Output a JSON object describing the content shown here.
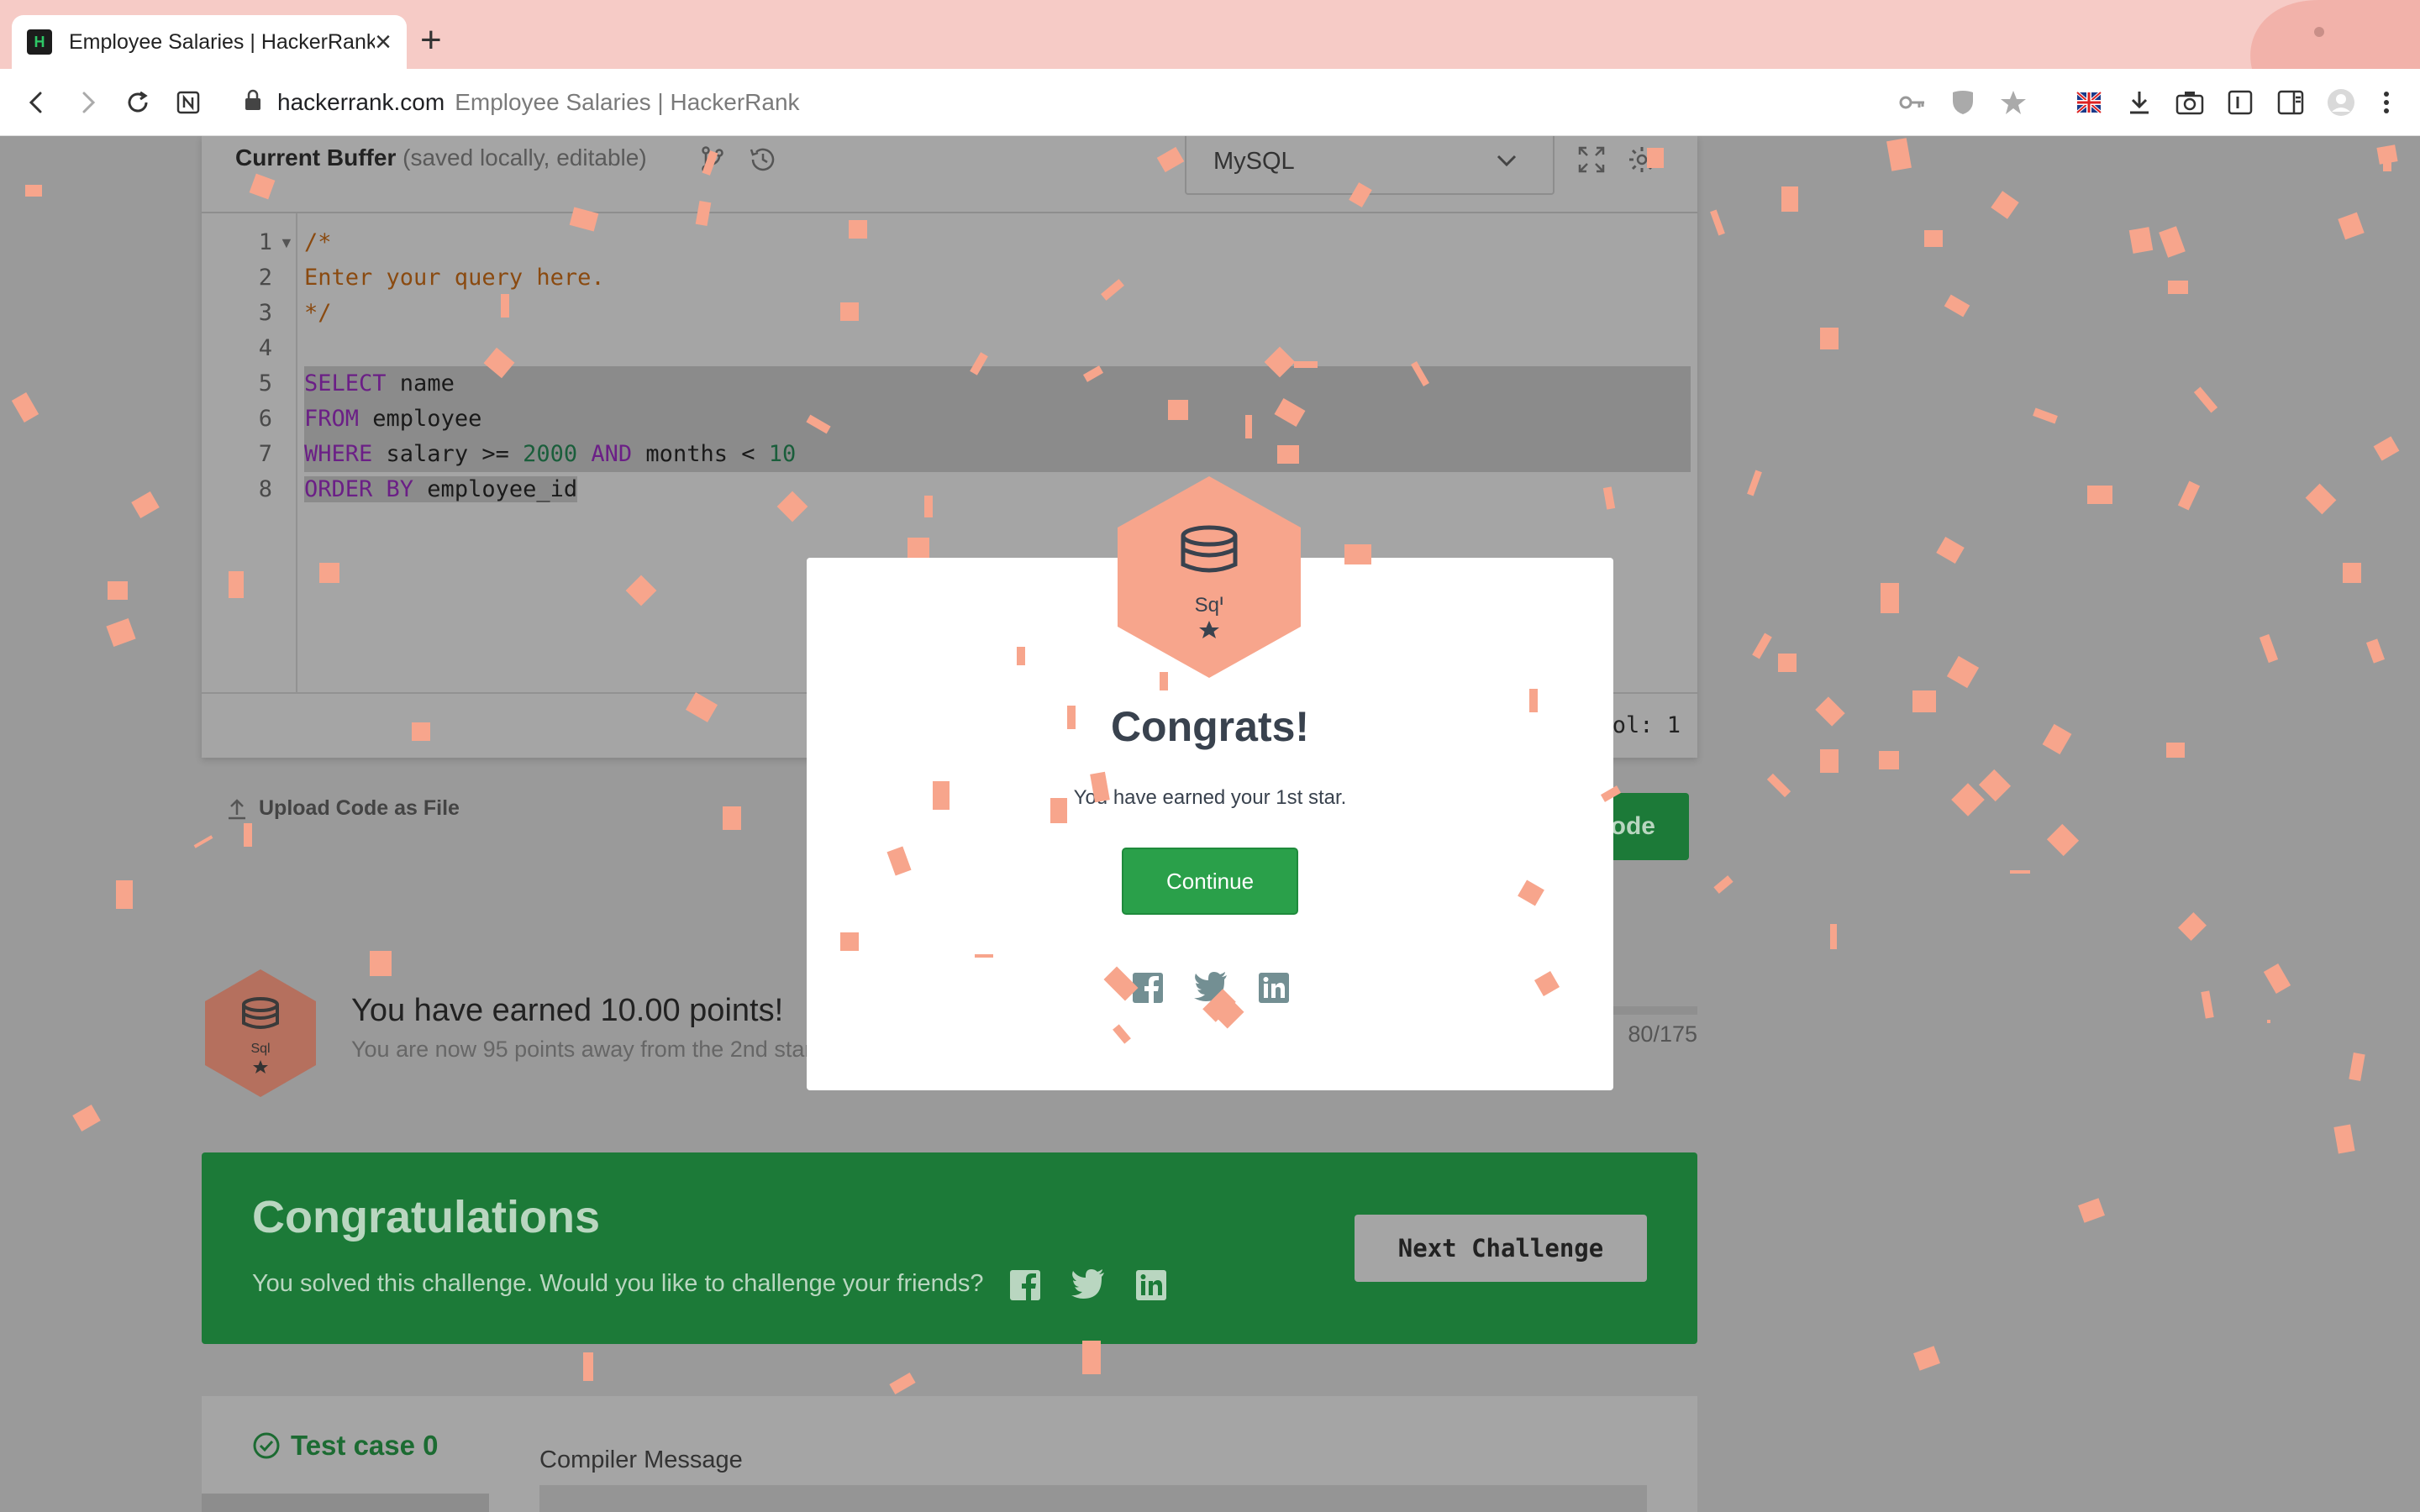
{
  "browser": {
    "tab_title": "Employee Salaries | HackerRank",
    "favicon_text": "H",
    "url_domain": "hackerrank.com",
    "url_page_title": "Employee Salaries | HackerRank"
  },
  "editor": {
    "buffer_title": "Current Buffer",
    "buffer_subtitle": "(saved locally, editable)",
    "language": "MySQL",
    "line_numbers": [
      "1",
      "2",
      "3",
      "4",
      "5",
      "6",
      "7",
      "8"
    ],
    "code_lines": [
      {
        "tokens": [
          {
            "t": "/*",
            "c": "cm"
          }
        ]
      },
      {
        "tokens": [
          {
            "t": "Enter your query here.",
            "c": "cm"
          }
        ]
      },
      {
        "tokens": [
          {
            "t": "*/",
            "c": "cm"
          }
        ]
      },
      {
        "tokens": []
      },
      {
        "tokens": [
          {
            "t": "SELECT",
            "c": "kw"
          },
          {
            "t": " name",
            "c": ""
          }
        ]
      },
      {
        "tokens": [
          {
            "t": "FROM",
            "c": "kw"
          },
          {
            "t": " employee",
            "c": ""
          }
        ]
      },
      {
        "tokens": [
          {
            "t": "WHERE",
            "c": "kw"
          },
          {
            "t": " salary >= ",
            "c": ""
          },
          {
            "t": "2000",
            "c": "num"
          },
          {
            "t": " ",
            "c": ""
          },
          {
            "t": "AND",
            "c": "kw"
          },
          {
            "t": " months < ",
            "c": ""
          },
          {
            "t": "10",
            "c": "num"
          }
        ]
      },
      {
        "tokens": [
          {
            "t": "ORDER BY",
            "c": "kw"
          },
          {
            "t": " employee_id",
            "c": ""
          }
        ]
      }
    ],
    "status_col": "Col: 1"
  },
  "actions": {
    "upload_label": "Upload Code as File",
    "submit_label": "ode"
  },
  "points": {
    "badge_label": "Sql",
    "earned_text": "You have earned 10.00 points!",
    "away_text": "You are now 95 points away from the 2nd star",
    "progress_text": "80/175"
  },
  "banner": {
    "title": "Congratulations",
    "subtitle": "You solved this challenge. Would you like to challenge your friends?",
    "next_button": "Next Challenge"
  },
  "testcase": {
    "label": "Test case 0",
    "compiler_label": "Compiler Message"
  },
  "modal": {
    "badge_label": "Sql",
    "title": "Congrats!",
    "subtitle": "You have earned your 1st star.",
    "continue_label": "Continue"
  },
  "colors": {
    "confetti": "#f7a58c",
    "success_green": "#2aa04a",
    "badge_orange": "#f7a58c",
    "tabstrip_pink": "#f6cbc6"
  }
}
